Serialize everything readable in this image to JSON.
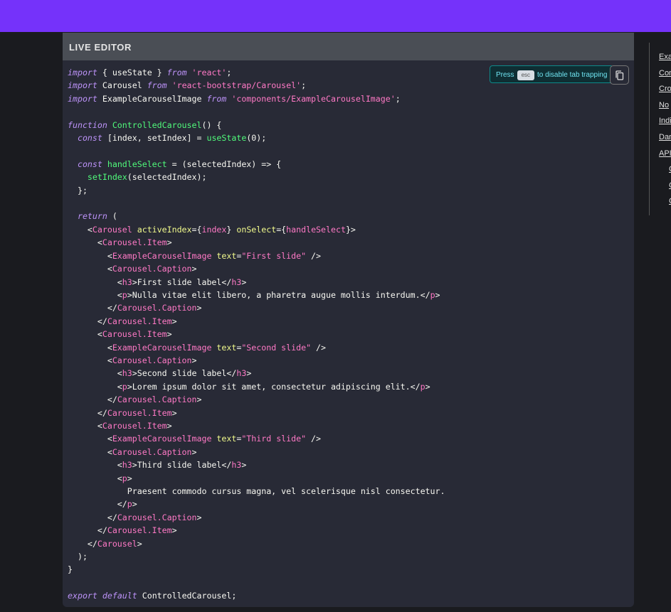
{
  "editor": {
    "title": "LIVE EDITOR",
    "esc_hint_before": "Press",
    "esc_key": "esc",
    "esc_hint_after": "to disable tab trapping",
    "code_lines": [
      [
        [
          "k",
          "import"
        ],
        [
          "p",
          " { useState } "
        ],
        [
          "k",
          "from"
        ],
        [
          "s",
          " 'react'"
        ],
        [
          "p",
          ";"
        ]
      ],
      [
        [
          "k",
          "import"
        ],
        [
          "p",
          " Carousel "
        ],
        [
          "k",
          "from"
        ],
        [
          "s",
          " 'react-bootstrap/Carousel'"
        ],
        [
          "p",
          ";"
        ]
      ],
      [
        [
          "k",
          "import"
        ],
        [
          "p",
          " ExampleCarouselImage "
        ],
        [
          "k",
          "from"
        ],
        [
          "s",
          " 'components/ExampleCarouselImage'"
        ],
        [
          "p",
          ";"
        ]
      ],
      [],
      [
        [
          "k",
          "function"
        ],
        [
          "p",
          " "
        ],
        [
          "f",
          "ControlledCarousel"
        ],
        [
          "p",
          "() {"
        ]
      ],
      [
        [
          "p",
          "  "
        ],
        [
          "k",
          "const"
        ],
        [
          "p",
          " [index, setIndex] = "
        ],
        [
          "f",
          "useState"
        ],
        [
          "p",
          "(0);"
        ]
      ],
      [],
      [
        [
          "p",
          "  "
        ],
        [
          "k",
          "const"
        ],
        [
          "p",
          " "
        ],
        [
          "f",
          "handleSelect"
        ],
        [
          "p",
          " = (selectedIndex) => {"
        ]
      ],
      [
        [
          "p",
          "    "
        ],
        [
          "f",
          "setIndex"
        ],
        [
          "p",
          "(selectedIndex);"
        ]
      ],
      [
        [
          "p",
          "  };"
        ]
      ],
      [],
      [
        [
          "p",
          "  "
        ],
        [
          "k",
          "return"
        ],
        [
          "p",
          " ("
        ]
      ],
      [
        [
          "p",
          "    <"
        ],
        [
          "t",
          "Carousel"
        ],
        [
          "p",
          " "
        ],
        [
          "a",
          "activeIndex"
        ],
        [
          "p",
          "={"
        ],
        [
          "t",
          "index"
        ],
        [
          "p",
          "} "
        ],
        [
          "a",
          "onSelect"
        ],
        [
          "p",
          "={"
        ],
        [
          "t",
          "handleSelect"
        ],
        [
          "p",
          "}>"
        ]
      ],
      [
        [
          "p",
          "      <"
        ],
        [
          "t",
          "Carousel.Item"
        ],
        [
          "p",
          ">"
        ]
      ],
      [
        [
          "p",
          "        <"
        ],
        [
          "t",
          "ExampleCarouselImage"
        ],
        [
          "p",
          " "
        ],
        [
          "a",
          "text"
        ],
        [
          "p",
          "="
        ],
        [
          "s",
          "\"First slide\""
        ],
        [
          "p",
          " />"
        ]
      ],
      [
        [
          "p",
          "        <"
        ],
        [
          "t",
          "Carousel.Caption"
        ],
        [
          "p",
          ">"
        ]
      ],
      [
        [
          "p",
          "          <"
        ],
        [
          "t",
          "h3"
        ],
        [
          "p",
          ">First slide label</"
        ],
        [
          "t",
          "h3"
        ],
        [
          "p",
          ">"
        ]
      ],
      [
        [
          "p",
          "          <"
        ],
        [
          "t",
          "p"
        ],
        [
          "p",
          ">Nulla vitae elit libero, a pharetra augue mollis interdum.</"
        ],
        [
          "t",
          "p"
        ],
        [
          "p",
          ">"
        ]
      ],
      [
        [
          "p",
          "        </"
        ],
        [
          "t",
          "Carousel.Caption"
        ],
        [
          "p",
          ">"
        ]
      ],
      [
        [
          "p",
          "      </"
        ],
        [
          "t",
          "Carousel.Item"
        ],
        [
          "p",
          ">"
        ]
      ],
      [
        [
          "p",
          "      <"
        ],
        [
          "t",
          "Carousel.Item"
        ],
        [
          "p",
          ">"
        ]
      ],
      [
        [
          "p",
          "        <"
        ],
        [
          "t",
          "ExampleCarouselImage"
        ],
        [
          "p",
          " "
        ],
        [
          "a",
          "text"
        ],
        [
          "p",
          "="
        ],
        [
          "s",
          "\"Second slide\""
        ],
        [
          "p",
          " />"
        ]
      ],
      [
        [
          "p",
          "        <"
        ],
        [
          "t",
          "Carousel.Caption"
        ],
        [
          "p",
          ">"
        ]
      ],
      [
        [
          "p",
          "          <"
        ],
        [
          "t",
          "h3"
        ],
        [
          "p",
          ">Second slide label</"
        ],
        [
          "t",
          "h3"
        ],
        [
          "p",
          ">"
        ]
      ],
      [
        [
          "p",
          "          <"
        ],
        [
          "t",
          "p"
        ],
        [
          "p",
          ">Lorem ipsum dolor sit amet, consectetur adipiscing elit.</"
        ],
        [
          "t",
          "p"
        ],
        [
          "p",
          ">"
        ]
      ],
      [
        [
          "p",
          "        </"
        ],
        [
          "t",
          "Carousel.Caption"
        ],
        [
          "p",
          ">"
        ]
      ],
      [
        [
          "p",
          "      </"
        ],
        [
          "t",
          "Carousel.Item"
        ],
        [
          "p",
          ">"
        ]
      ],
      [
        [
          "p",
          "      <"
        ],
        [
          "t",
          "Carousel.Item"
        ],
        [
          "p",
          ">"
        ]
      ],
      [
        [
          "p",
          "        <"
        ],
        [
          "t",
          "ExampleCarouselImage"
        ],
        [
          "p",
          " "
        ],
        [
          "a",
          "text"
        ],
        [
          "p",
          "="
        ],
        [
          "s",
          "\"Third slide\""
        ],
        [
          "p",
          " />"
        ]
      ],
      [
        [
          "p",
          "        <"
        ],
        [
          "t",
          "Carousel.Caption"
        ],
        [
          "p",
          ">"
        ]
      ],
      [
        [
          "p",
          "          <"
        ],
        [
          "t",
          "h3"
        ],
        [
          "p",
          ">Third slide label</"
        ],
        [
          "t",
          "h3"
        ],
        [
          "p",
          ">"
        ]
      ],
      [
        [
          "p",
          "          <"
        ],
        [
          "t",
          "p"
        ],
        [
          "p",
          ">"
        ]
      ],
      [
        [
          "p",
          "            Praesent commodo cursus magna, vel scelerisque nisl consectetur."
        ]
      ],
      [
        [
          "p",
          "          </"
        ],
        [
          "t",
          "p"
        ],
        [
          "p",
          ">"
        ]
      ],
      [
        [
          "p",
          "        </"
        ],
        [
          "t",
          "Carousel.Caption"
        ],
        [
          "p",
          ">"
        ]
      ],
      [
        [
          "p",
          "      </"
        ],
        [
          "t",
          "Carousel.Item"
        ],
        [
          "p",
          ">"
        ]
      ],
      [
        [
          "p",
          "    </"
        ],
        [
          "t",
          "Carousel"
        ],
        [
          "p",
          ">"
        ]
      ],
      [
        [
          "p",
          "  );"
        ]
      ],
      [
        [
          "p",
          "}"
        ]
      ],
      [],
      [
        [
          "k",
          "export"
        ],
        [
          "p",
          " "
        ],
        [
          "k",
          "default"
        ],
        [
          "p",
          " ControlledCarousel;"
        ]
      ]
    ]
  },
  "toc": {
    "items": [
      {
        "label": "Exa",
        "indent": 0
      },
      {
        "label": "Con",
        "indent": 0
      },
      {
        "label": "Cro",
        "indent": 0
      },
      {
        "label": "No",
        "indent": 0
      },
      {
        "label": "Indi",
        "indent": 0
      },
      {
        "label": "Dar",
        "indent": 0
      },
      {
        "label": "API",
        "indent": 0
      },
      {
        "label": "C",
        "indent": 1
      },
      {
        "label": "C",
        "indent": 1
      },
      {
        "label": "C",
        "indent": 1
      }
    ]
  },
  "colors": {
    "topbar": "#7532fa",
    "page_bg": "#1a1b1f",
    "editor_bg": "#282a36",
    "header_bg": "#4a4e55"
  }
}
